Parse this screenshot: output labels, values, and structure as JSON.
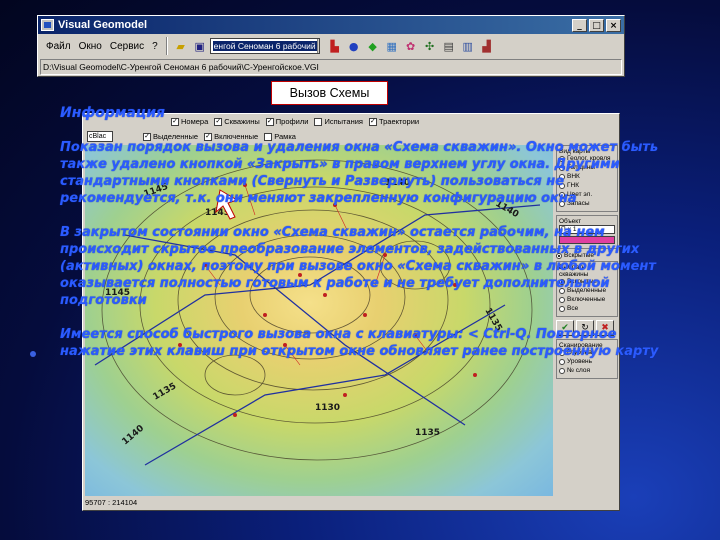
{
  "app": {
    "title": "Visual Geomodel",
    "window_controls": [
      "_",
      "□",
      "×"
    ],
    "menu": [
      "Файл",
      "Окно",
      "Сервис",
      "?"
    ],
    "project_combo": "енгой Сеноман 6 рабочий",
    "path": "D:\\Visual Geomodel\\С-Уренгой Сеноман 6 рабочий\\С-Уренгойское.VGI"
  },
  "call_button": "Вызов Схемы",
  "map_window": {
    "toolbar_checks": [
      {
        "label": "Номера",
        "checked": true
      },
      {
        "label": "Скважины",
        "checked": true
      },
      {
        "label": "Профили",
        "checked": true
      },
      {
        "label": "Испытания",
        "checked": false
      },
      {
        "label": "Траектории",
        "checked": true
      }
    ],
    "toolbar2_combo": "cBlac",
    "toolbar2_checks": [
      {
        "label": "Выделенные",
        "checked": true
      },
      {
        "label": "Включенные",
        "checked": true
      },
      {
        "label": "Рамка",
        "checked": false
      }
    ],
    "status": "95707 : 214104",
    "contour_labels": [
      "1145",
      "1140",
      "1135",
      "1145",
      "1135",
      "1140",
      "1130",
      "1135",
      "1140",
      "1145"
    ],
    "side_panel": {
      "view_header": "Вид карты",
      "view_options": [
        {
          "label": "Геолог. кровля",
          "on": true
        },
        {
          "label": "Толщины",
          "on": false
        },
        {
          "label": "ВНК",
          "on": false
        },
        {
          "label": "ГНК",
          "on": false
        },
        {
          "label": "Цвет эл.",
          "on": false
        },
        {
          "label": "Запасы",
          "on": false
        }
      ],
      "object_header": "Объект",
      "object_value": "П-х 1",
      "all_label": "Вскрытые",
      "select_header": "Выбрать скважины",
      "select_options": [
        {
          "label": "Вскрытые",
          "on": true
        },
        {
          "label": "Выделенные",
          "on": false
        },
        {
          "label": "Включенные",
          "on": false
        },
        {
          "label": "Все",
          "on": false
        }
      ],
      "scan_header": "Сканирование",
      "scan_options": [
        "Глубина",
        "Уровень",
        "№ слоя"
      ]
    },
    "color_accent": "#e040a0"
  },
  "slide": {
    "heading": "Информация",
    "p1": "Показан порядок вызова и удаления окна «Схема скважин». Окно может быть также удалено кнопкой «Закрыть» в правом верхнем углу окна. Другими стандартными кнопками (Свернуть и Развернуть) пользоваться не рекомендуется, т.к. они меняют закрепленную конфигурацию окна",
    "p2": "В закрытом состоянии окно «Схема скважин» остается рабочим, на нем происходит скрытое преобразование элементов, задействованных в других (активных) окнах, поэтому при вызове окно «Схема скважин» в любой момент оказывается полностью готовым к работе и не требует дополнительной подготовки",
    "p3": "Имеется способ быстрого вызова окна с клавиатуры: < Ctrl-Q. Повторное нажатие этих клавиш при открытом окне обновляет ранее построенную карту",
    "text_color": "#2b5bff"
  }
}
